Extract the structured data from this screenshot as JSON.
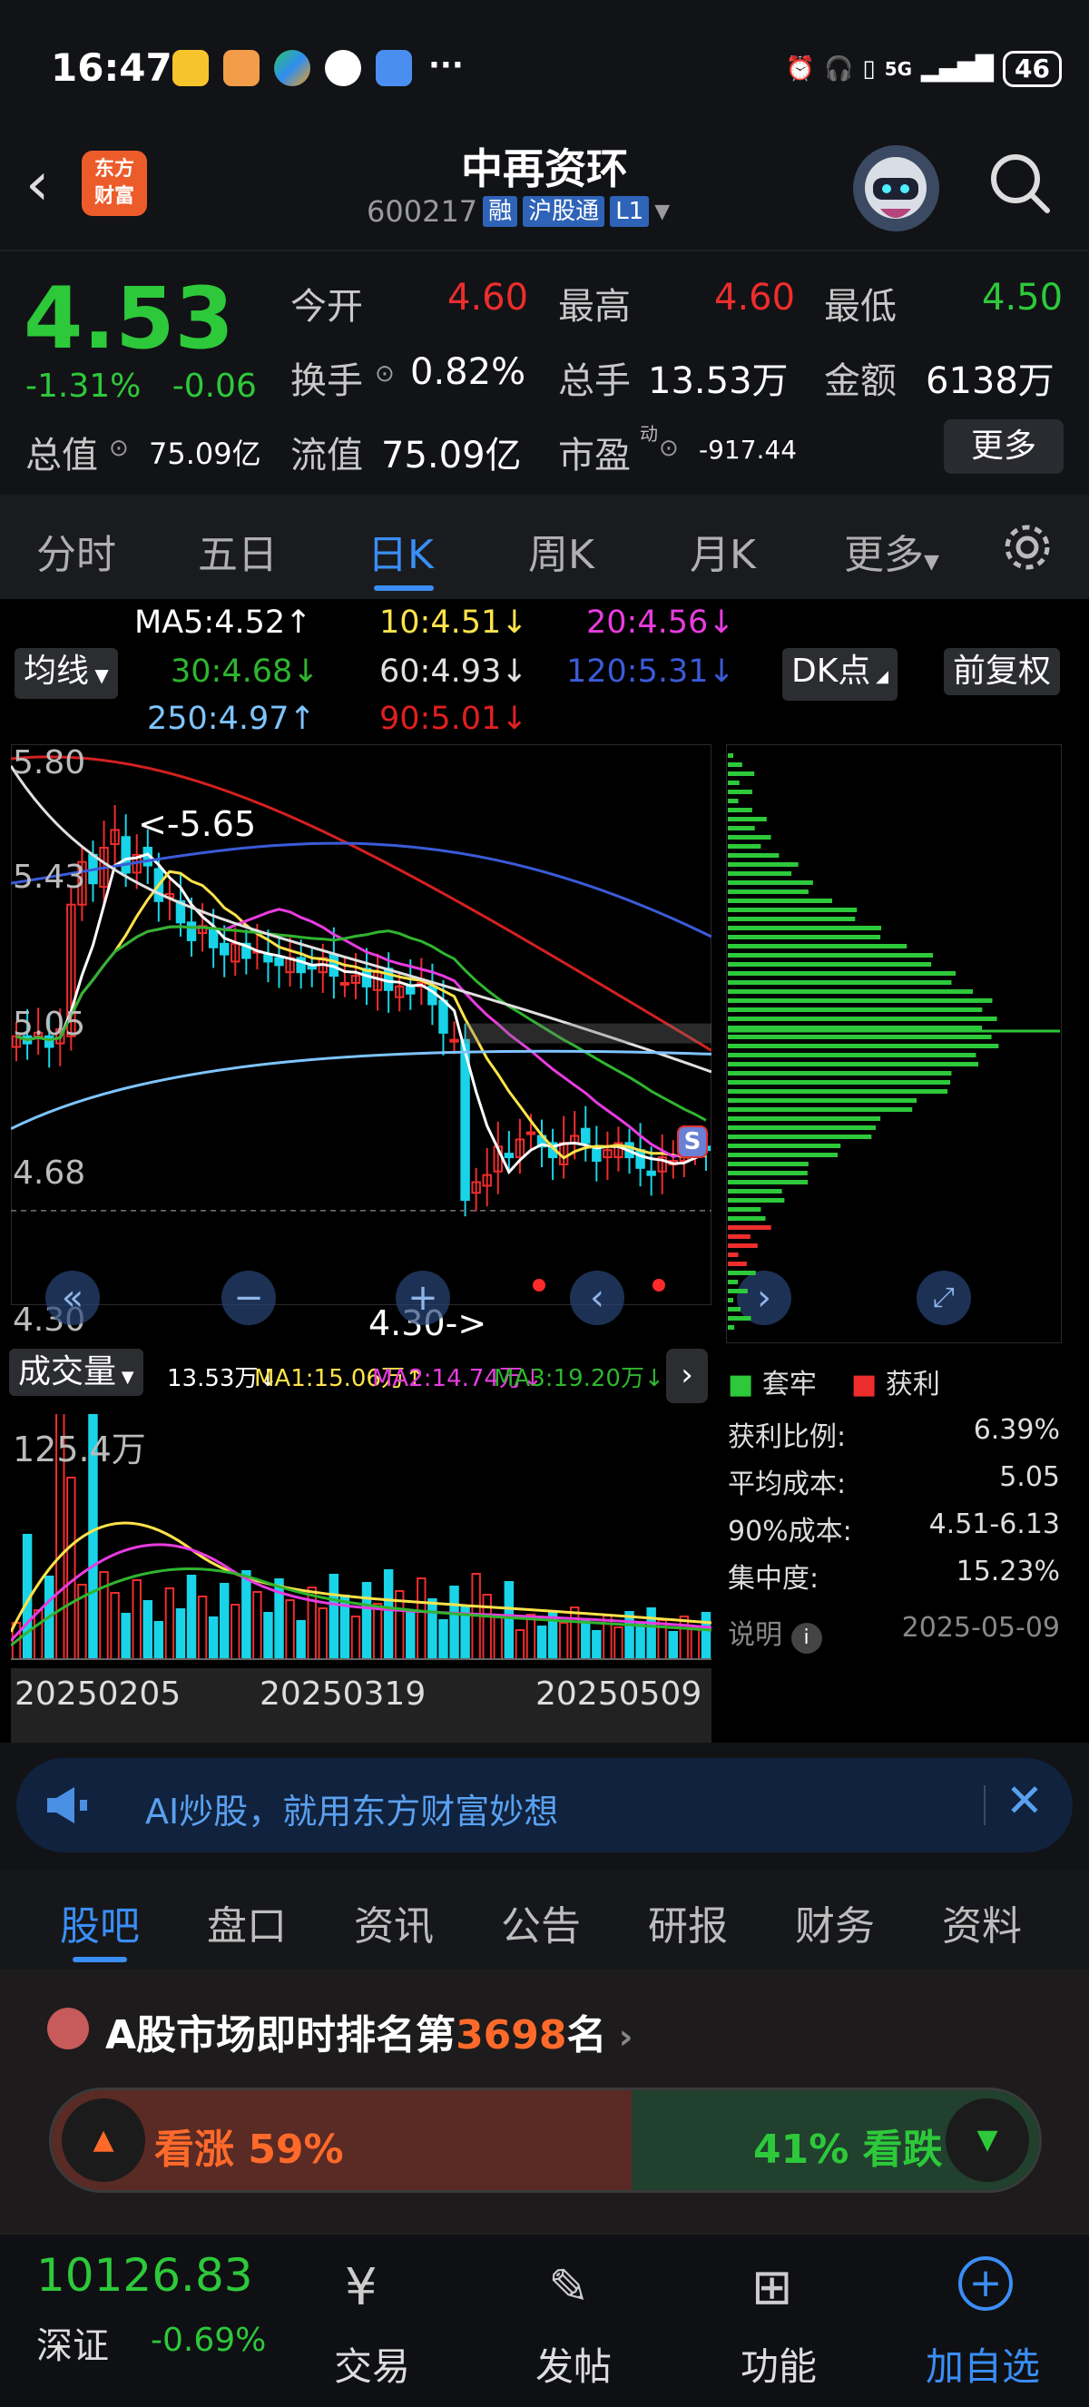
{
  "status_bar": {
    "time": "16:47",
    "dots": "···",
    "network": "5G",
    "battery": "46"
  },
  "header": {
    "logo_line1": "东方",
    "logo_line2": "财富",
    "title": "中再资环",
    "code": "600217",
    "tags": [
      "融",
      "沪股通",
      "L1"
    ]
  },
  "quote": {
    "price": "4.53",
    "change_pct": "-1.31%",
    "change_amt": "-0.06",
    "open_label": "今开",
    "open": "4.60",
    "high_label": "最高",
    "high": "4.60",
    "low_label": "最低",
    "low": "4.50",
    "turnover_label": "换手",
    "turnover": "0.82%",
    "volume_label": "总手",
    "volume": "13.53万",
    "amount_label": "金额",
    "amount": "6138万",
    "mcap_label": "总值",
    "mcap": "75.09亿",
    "float_label": "流值",
    "float": "75.09亿",
    "pe_label": "市盈",
    "pe_sup": "动",
    "pe": "-917.44",
    "more": "更多"
  },
  "tabs": [
    "分时",
    "五日",
    "日K",
    "周K",
    "月K",
    "更多"
  ],
  "ma": {
    "ma5": "MA5:4.52↑",
    "ma10": "10:4.51↓",
    "ma20": "20:4.56↓",
    "ma30": "30:4.68↓",
    "ma60": "60:4.93↓",
    "ma120": "120:5.31↓",
    "ma250": "250:4.97↑",
    "ma90": "90:5.01↓",
    "line_btn": "均线",
    "dk_btn": "DK点",
    "adj_btn": "前复权"
  },
  "chart_data": {
    "type": "candlestick",
    "y_ticks": [
      "5.80",
      "5.43",
      "5.05",
      "4.68",
      "4.30"
    ],
    "annotation_high": "<-5.65",
    "annotation_low": "4.30->",
    "badge": "S",
    "volume_label": "成交量",
    "volume_max": "125.4万",
    "volume_ma": {
      "cur": "13.53万↓",
      "ma1": "MA1:15.06万↑",
      "ma2": "MA2:14.74万↓",
      "ma3": "MA3:19.20万↓"
    },
    "x_labels": [
      "20250205",
      "20250319",
      "20250509"
    ],
    "colors": {
      "up": "#ee2d2d",
      "down": "#19d4e8",
      "ma5": "#ffffff",
      "ma10": "#ffe34a",
      "ma20": "#e83ce0",
      "ma30": "#2fb52f",
      "ma60": "#e0e0e0",
      "ma120": "#3b5bd8",
      "ma250": "#7ec4ff",
      "ma90": "#d42020"
    }
  },
  "chip": {
    "legend_trap": "套牢",
    "legend_profit": "获利",
    "rows": [
      {
        "k": "获利比例:",
        "v": "6.39%"
      },
      {
        "k": "平均成本:",
        "v": "5.05"
      },
      {
        "k": "90%成本:",
        "v": "4.51-6.13"
      },
      {
        "k": "集中度:",
        "v": "15.23%"
      }
    ],
    "note_label": "说明",
    "date": "2025-05-09"
  },
  "banner": {
    "text": "AI炒股，就用东方财富妙想"
  },
  "section_tabs": [
    "股吧",
    "盘口",
    "资讯",
    "公告",
    "研报",
    "财务",
    "资料"
  ],
  "rank": {
    "prefix": "A股市场即时排名第",
    "number": "3698",
    "suffix": "名",
    "up_label": "看涨 59%",
    "down_label": "41% 看跌",
    "up_fraction": 0.59
  },
  "bottom": {
    "index_value": "10126.83",
    "index_name": "深证",
    "index_change": "-0.69%",
    "nav": [
      "交易",
      "发帖",
      "功能",
      "加自选"
    ]
  }
}
